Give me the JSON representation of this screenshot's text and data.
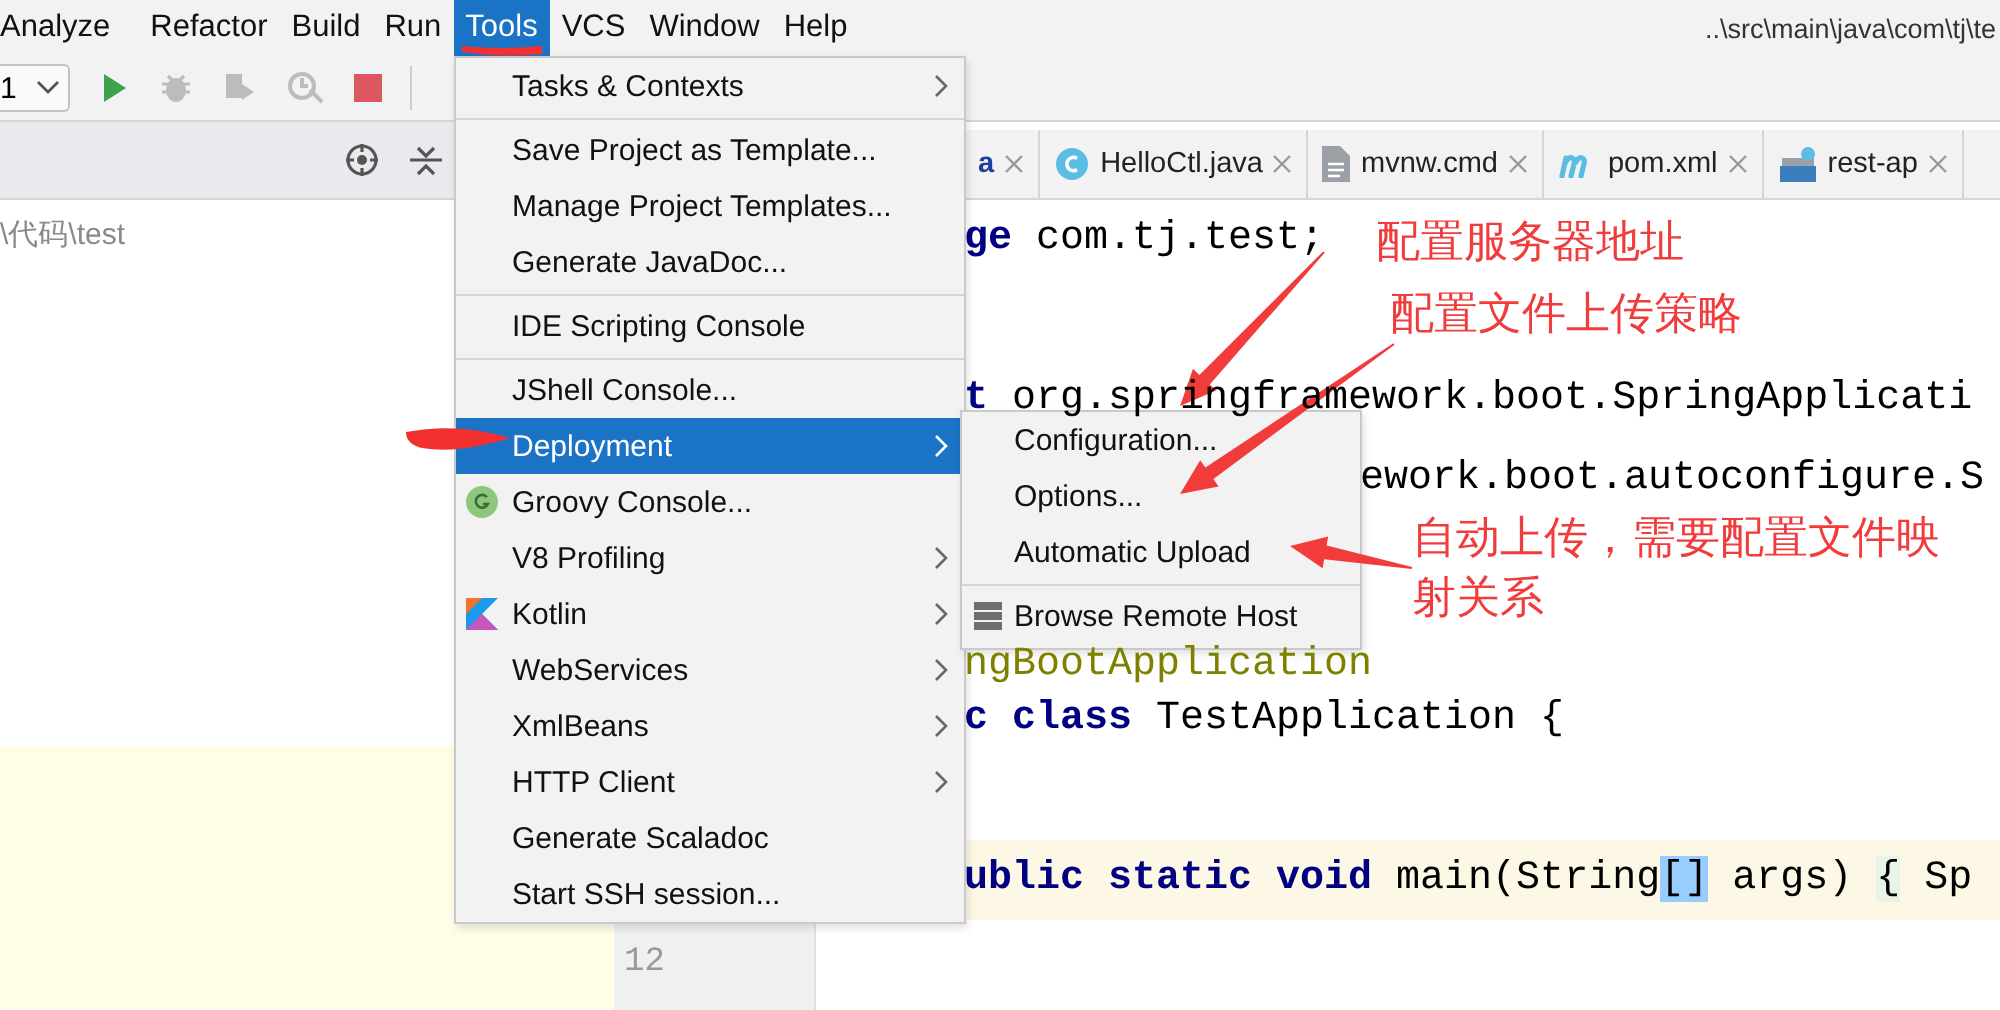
{
  "menu_bar": [
    {
      "label": "Analyze",
      "selected": false
    },
    {
      "label": "Refactor",
      "selected": false
    },
    {
      "label": "Build",
      "selected": false
    },
    {
      "label": "Run",
      "selected": false
    },
    {
      "label": "Tools",
      "selected": true
    },
    {
      "label": "VCS",
      "selected": false
    },
    {
      "label": "Window",
      "selected": false
    },
    {
      "label": "Help",
      "selected": false
    }
  ],
  "title_path": "..\\src\\main\\java\\com\\tj\\te",
  "toolbar": {
    "config_value": "1"
  },
  "project_pane": {
    "path": "\\代码\\test"
  },
  "editor_tabs": [
    {
      "label": "a",
      "kind": "plain",
      "selected": false
    },
    {
      "label": "HelloCtl.java",
      "kind": "java",
      "selected": false
    },
    {
      "label": "mvnw.cmd",
      "kind": "file",
      "selected": false
    },
    {
      "label": "pom.xml",
      "kind": "maven",
      "selected": false
    },
    {
      "label": "rest-ap",
      "kind": "api",
      "selected": false
    }
  ],
  "code_lines": [
    {
      "highlighted": false,
      "tokens": [
        {
          "text": "ge",
          "kind": "keyword"
        },
        {
          "text": " com.tj.test;",
          "kind": "plain"
        }
      ]
    },
    {
      "highlighted": false
    },
    {
      "highlighted": false,
      "tokens": [
        {
          "text": "t",
          "kind": "keyword"
        },
        {
          "text": " org.springframework.boot.SpringApplicati",
          "kind": "plain"
        }
      ]
    },
    {
      "highlighted": false,
      "tokens": [
        {
          "text": "ework.boot.autoconfigure.S",
          "kind": "plain"
        }
      ]
    },
    {
      "highlighted": false
    },
    {
      "highlighted": false,
      "tokens": [
        {
          "text": "ngBootApplication",
          "kind": "annotation"
        }
      ]
    },
    {
      "highlighted": false,
      "tokens": [
        {
          "text": "c class",
          "kind": "keyword"
        },
        {
          "text": " TestApplication {",
          "kind": "plain"
        }
      ]
    },
    {
      "highlighted": false
    },
    {
      "highlighted": true,
      "tokens": [
        {
          "text": "ublic static void",
          "kind": "keyword"
        },
        {
          "text": " main(String",
          "kind": "plain"
        },
        {
          "text": "[]",
          "kind": "bracket_match"
        },
        {
          "text": " args) ",
          "kind": "plain"
        },
        {
          "text": "{",
          "kind": "brace_match"
        },
        {
          "text": " Sp",
          "kind": "plain"
        }
      ]
    }
  ],
  "gutter": {
    "line_number": "12"
  },
  "tools_menu": {
    "items": [
      {
        "label": "Tasks & Contexts",
        "kind": "plain",
        "submenu": true,
        "separator_before": false,
        "selected": false
      },
      {
        "label": "Save Project as Template...",
        "kind": "plain",
        "submenu": false,
        "separator_before": true,
        "selected": false
      },
      {
        "label": "Manage Project Templates...",
        "kind": "plain",
        "submenu": false,
        "separator_before": false,
        "selected": false
      },
      {
        "label": "Generate JavaDoc...",
        "kind": "plain",
        "submenu": false,
        "separator_before": false,
        "selected": false
      },
      {
        "label": "IDE Scripting Console",
        "kind": "plain",
        "submenu": false,
        "separator_before": true,
        "selected": false
      },
      {
        "label": "JShell Console...",
        "kind": "plain",
        "submenu": false,
        "separator_before": true,
        "selected": false
      },
      {
        "label": "Deployment",
        "kind": "plain",
        "submenu": true,
        "separator_before": false,
        "selected": true
      },
      {
        "label": "Groovy Console...",
        "kind": "groovy",
        "submenu": false,
        "separator_before": false,
        "selected": false
      },
      {
        "label": "V8 Profiling",
        "kind": "plain",
        "submenu": true,
        "separator_before": false,
        "selected": false
      },
      {
        "label": "Kotlin",
        "kind": "kotlin",
        "submenu": true,
        "separator_before": false,
        "selected": false
      },
      {
        "label": "WebServices",
        "kind": "plain",
        "submenu": true,
        "separator_before": false,
        "selected": false
      },
      {
        "label": "XmlBeans",
        "kind": "plain",
        "submenu": true,
        "separator_before": false,
        "selected": false
      },
      {
        "label": "HTTP Client",
        "kind": "plain",
        "submenu": true,
        "separator_before": false,
        "selected": false
      },
      {
        "label": "Generate Scaladoc",
        "kind": "plain",
        "submenu": false,
        "separator_before": false,
        "selected": false
      },
      {
        "label": "Start SSH session...",
        "kind": "plain",
        "submenu": false,
        "separator_before": false,
        "selected": false
      }
    ]
  },
  "deployment_submenu": {
    "items": [
      {
        "label": "Configuration...",
        "kind": "plain",
        "separator_before": false
      },
      {
        "label": "Options...",
        "kind": "plain",
        "separator_before": false
      },
      {
        "label": "Automatic Upload",
        "kind": "plain",
        "separator_before": false
      },
      {
        "label": "Browse Remote Host",
        "kind": "server",
        "separator_before": true
      }
    ]
  },
  "annotations": [
    {
      "text": "配置服务器地址"
    },
    {
      "text": "配置文件上传策略"
    },
    {
      "text": "自动上传，需要配置文件映射关系"
    }
  ]
}
